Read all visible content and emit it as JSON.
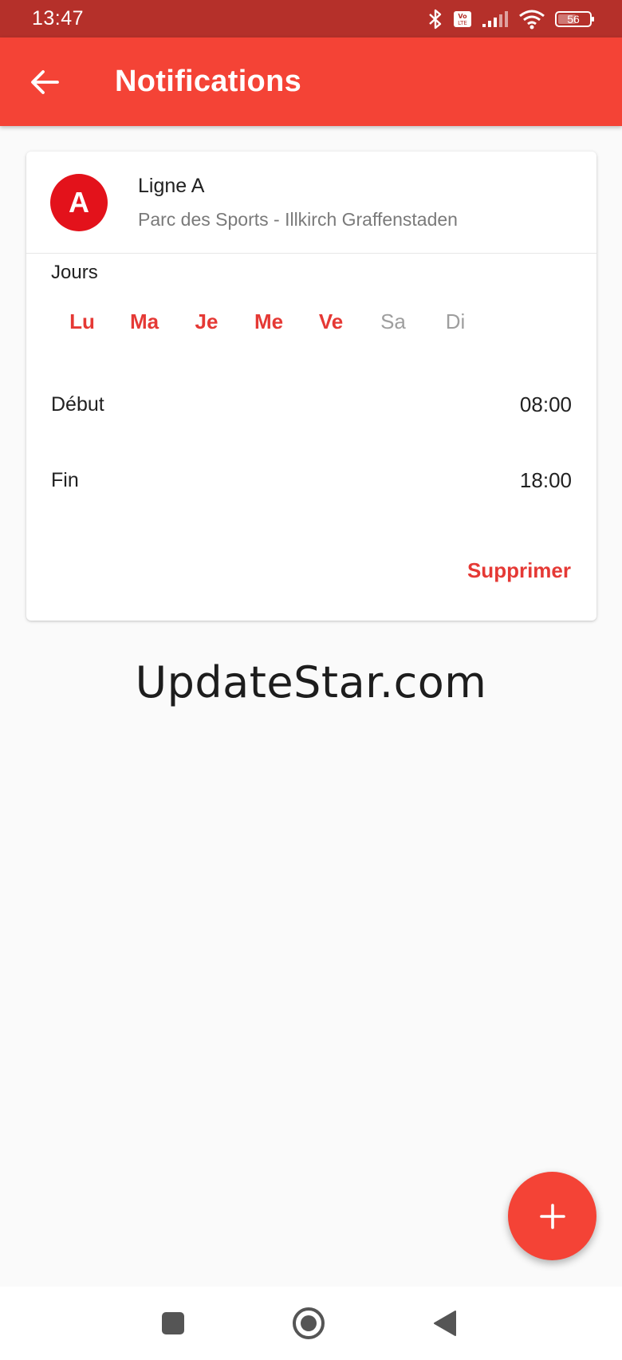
{
  "status_bar": {
    "time": "13:47",
    "battery": "56",
    "icons": [
      "bluetooth-icon",
      "volte-icon",
      "signal-icon",
      "wifi-icon",
      "battery-icon"
    ]
  },
  "app_bar": {
    "title": "Notifications",
    "back_icon": "arrow-left-icon"
  },
  "notification": {
    "line_badge": "A",
    "line_name": "Ligne A",
    "stop_name": "Parc des Sports - Illkirch Graffenstaden",
    "days_label": "Jours",
    "days": [
      {
        "label": "Lu",
        "active": true
      },
      {
        "label": "Ma",
        "active": true
      },
      {
        "label": "Je",
        "active": true
      },
      {
        "label": "Me",
        "active": true
      },
      {
        "label": "Ve",
        "active": true
      },
      {
        "label": "Sa",
        "active": false
      },
      {
        "label": "Di",
        "active": false
      }
    ],
    "start_label": "Début",
    "start_time": "08:00",
    "end_label": "Fin",
    "end_time": "18:00",
    "delete_label": "Supprimer"
  },
  "watermark": "UpdateStar.com",
  "fab_icon": "plus-icon",
  "nav_bar": {
    "icons": [
      "recents-square-icon",
      "home-circle-icon",
      "back-triangle-icon"
    ]
  },
  "colors": {
    "primary": "#f44336",
    "status_bar": "#b5302a",
    "accent_text": "#e53935",
    "line_badge": "#e3121b"
  }
}
